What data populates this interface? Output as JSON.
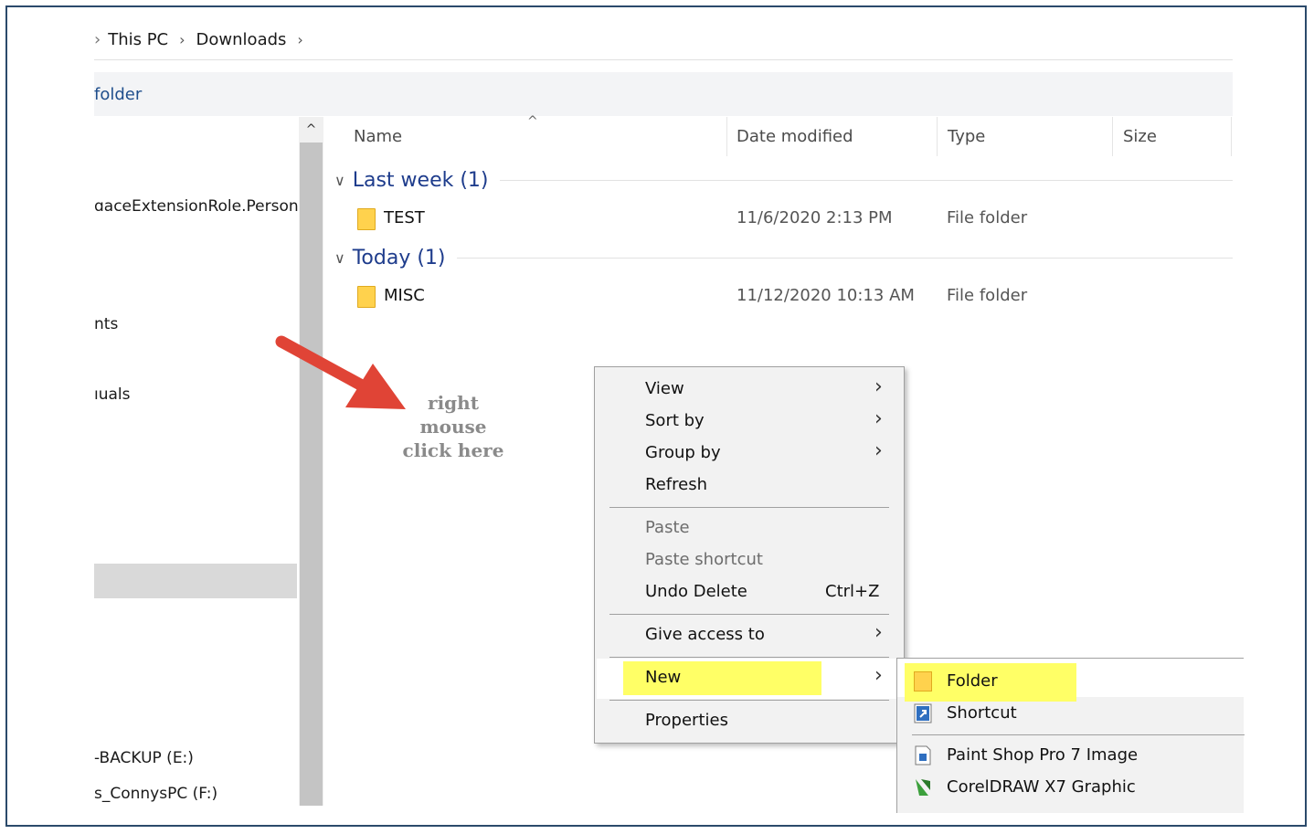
{
  "breadcrumb": {
    "lead": "›",
    "items": [
      "This PC",
      "Downloads"
    ],
    "trailing": "›"
  },
  "ribbon": {
    "label": "folder"
  },
  "nav": {
    "items": [
      "ɑaceExtensionRole.Persona",
      "nts",
      "ıuals",
      "-BACKUP (E:)",
      "s_ConnysPC (F:)"
    ],
    "scroll_up_glyph": "^"
  },
  "columns": {
    "name": "Name",
    "date": "Date modified",
    "type": "Type",
    "size": "Size",
    "sort_glyph": "^"
  },
  "groups": [
    {
      "title": "Last week (1)",
      "files": [
        {
          "name": "TEST",
          "date": "11/6/2020 2:13 PM",
          "type": "File folder"
        }
      ]
    },
    {
      "title": "Today (1)",
      "files": [
        {
          "name": "MISC",
          "date": "11/12/2020 10:13 AM",
          "type": "File folder"
        }
      ]
    }
  ],
  "annotation": {
    "line1": "right",
    "line2": "mouse",
    "line3": "click here",
    "arrow_color": "#e04436",
    "highlight_color": "#ffff66"
  },
  "context_menu": {
    "view": "View",
    "sort_by": "Sort by",
    "group_by": "Group by",
    "refresh": "Refresh",
    "paste": "Paste",
    "paste_shortcut": "Paste shortcut",
    "undo_delete": "Undo Delete",
    "undo_shortcut": "Ctrl+Z",
    "give_access": "Give access to",
    "new": "New",
    "properties": "Properties",
    "submenu_arrow": "›"
  },
  "submenu": {
    "folder": "Folder",
    "shortcut": "Shortcut",
    "psp_image": "Paint Shop Pro 7 Image",
    "coreldraw": "CorelDRAW X7 Graphic"
  }
}
